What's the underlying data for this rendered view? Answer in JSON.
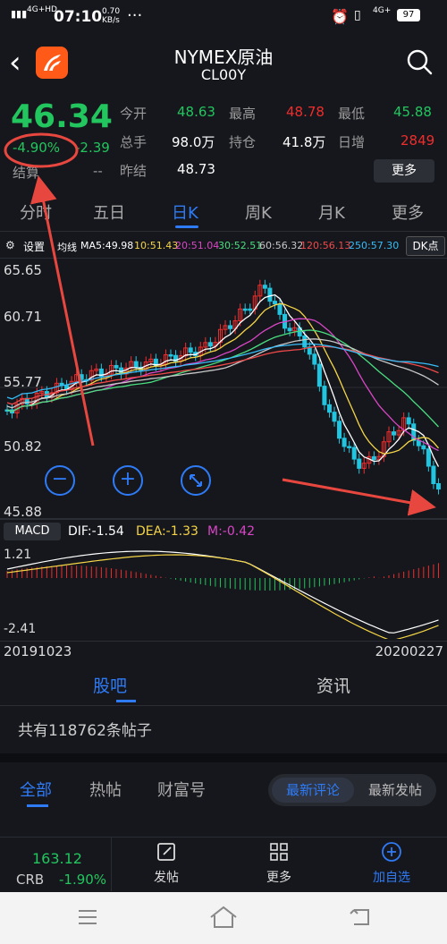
{
  "status_bar": {
    "network": "4G+HD",
    "time": "07:10",
    "speed": "0.70 KB/s",
    "dots": "···",
    "net2": "4G+",
    "battery": "97"
  },
  "header": {
    "title": "NYMEX原油",
    "code": "CL00Y",
    "icons": [
      "back-icon",
      "app-logo",
      "search-icon"
    ]
  },
  "quote": {
    "price": "46.34",
    "change_pct": "-4.90%",
    "change": "-2.39",
    "settle_label": "结算",
    "settle_value": "--",
    "open_label": "今开",
    "open_value": "48.63",
    "high_label": "最高",
    "high_value": "48.78",
    "low_label": "最低",
    "low_value": "45.88",
    "volume_label": "总手",
    "volume_value": "98.0万",
    "oi_label": "持仓",
    "oi_value": "41.8万",
    "daily_label": "日增",
    "daily_value": "2849",
    "prev_label": "昨结",
    "prev_value": "48.73",
    "more_button": "更多"
  },
  "tabs": [
    "分时",
    "五日",
    "日K",
    "周K",
    "月K",
    "更多"
  ],
  "active_tab": 2,
  "ma_bar": {
    "settings": "设置",
    "ma_label": "均线",
    "ma5": "MA5:49.98",
    "ma10": "10:51.43",
    "ma20": "20:51.04",
    "ma30": "30:52.51",
    "ma60": "60:56.32",
    "ma120": "120:56.13",
    "ma250": "250:57.30",
    "dk": "DK点"
  },
  "price_axis": [
    "65.65",
    "60.71",
    "55.77",
    "50.82",
    "45.88"
  ],
  "macd": {
    "label": "MACD",
    "dif": "DIF:-1.54",
    "dea": "DEA:-1.33",
    "m": "M:-0.42",
    "axis_top": "1.21",
    "axis_bottom": "-2.41"
  },
  "dates": {
    "start": "20191023",
    "end": "20200227"
  },
  "bottom_tabs": [
    "股吧",
    "资讯"
  ],
  "post_count": "共有118762条帖子",
  "sub_tabs": [
    "全部",
    "热帖",
    "财富号"
  ],
  "sort_options": [
    "最新评论",
    "最新发帖"
  ],
  "nav": {
    "crb_value": "163.12",
    "crb_label": "CRB",
    "crb_change": "-1.90%",
    "post": "发帖",
    "more": "更多",
    "add": "加自选"
  },
  "colors": {
    "up": "#ef2d2d",
    "down": "#22c55e",
    "accent": "#2f7bf6",
    "annotation": "#e8473f"
  }
}
